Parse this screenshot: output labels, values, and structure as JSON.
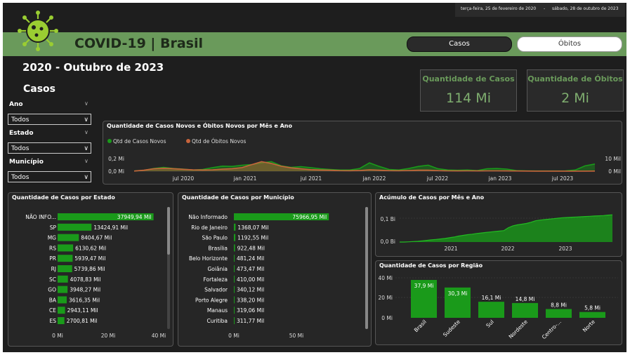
{
  "header": {
    "title": "COVID-19 | Brasil",
    "period": "2020 - Outubro de 2023",
    "section": "Casos",
    "date_start": "terça-feira, 25 de fevereiro de 2020",
    "date_sep": "-",
    "date_end": "sábado, 28 de outubro de 2023",
    "btn_casos": "Casos",
    "btn_obitos": "Óbitos"
  },
  "kpis": {
    "casos_label": "Quantidade de Casos",
    "casos_value": "114 Mi",
    "obitos_label": "Quantidade de Óbitos",
    "obitos_value": "2 Mi"
  },
  "filters": {
    "ano_label": "Ano",
    "ano_value": "Todos",
    "estado_label": "Estado",
    "estado_value": "Todos",
    "municipio_label": "Município",
    "municipio_value": "Todos"
  },
  "colors": {
    "green": "#1a9a1a",
    "accent": "#6a9a5b",
    "orange": "#c8643c"
  },
  "chart_data": [
    {
      "type": "area",
      "title": "Quantidade de Casos Novos e Óbitos Novos por Mês e Ano",
      "legend": "top-left",
      "x_ticks": [
        "jul 2020",
        "jan 2021",
        "jul 2021",
        "jan 2022",
        "jul 2022",
        "jan 2023",
        "jul 2023"
      ],
      "left_axis_ticks": [
        "0,2 Mi",
        "0,0 Mi"
      ],
      "right_axis_ticks": [
        "10 Mil",
        "0 Mil"
      ],
      "series": [
        {
          "name": "Qtd de Casos Novos",
          "values": [
            0.003,
            0.015,
            0.045,
            0.065,
            0.045,
            0.035,
            0.02,
            0.03,
            0.06,
            0.085,
            0.08,
            0.1,
            0.11,
            0.14,
            0.16,
            0.09,
            0.065,
            0.075,
            0.06,
            0.04,
            0.03,
            0.02,
            0.02,
            0.045,
            0.14,
            0.08,
            0.03,
            0.02,
            0.045,
            0.08,
            0.1,
            0.04,
            0.02,
            0.015,
            0.02,
            0.01,
            0.04,
            0.045,
            0.035,
            0.01,
            0.005,
            0.004,
            0.003,
            0.003,
            0.005,
            0.02,
            0.09,
            0.12
          ]
        },
        {
          "name": "Qtd de Óbitos Novos",
          "values": [
            0.1,
            0.8,
            2.0,
            2.5,
            2.1,
            1.6,
            1.2,
            1.0,
            1.2,
            1.7,
            2.1,
            3.0,
            5.5,
            8.0,
            6.5,
            4.2,
            2.8,
            2.0,
            1.3,
            1.0,
            0.8,
            0.5,
            0.4,
            0.6,
            1.2,
            0.8,
            0.5,
            0.4,
            0.6,
            0.8,
            0.9,
            0.5,
            0.3,
            0.25,
            0.3,
            0.25,
            0.3,
            0.3,
            0.25,
            0.15,
            0.1,
            0.08,
            0.07,
            0.05,
            0.05,
            0.06,
            0.08,
            0.1
          ]
        }
      ],
      "ylim_left": [
        0,
        0.2
      ],
      "ylim_right": [
        0,
        10
      ]
    },
    {
      "type": "bar",
      "title": "Quantidade de Casos por Estado",
      "categories": [
        "NÃO INFO...",
        "SP",
        "MG",
        "RS",
        "PR",
        "RJ",
        "SC",
        "GO",
        "BA",
        "CE",
        "ES"
      ],
      "values": [
        37949.94,
        13424.91,
        8404.67,
        6130.62,
        5939.47,
        5739.86,
        4078.83,
        3948.27,
        3616.35,
        2943.11,
        2700.81
      ],
      "labels": [
        "37949,94 Mil",
        "13424,91 Mil",
        "8404,67 Mil",
        "6130,62 Mil",
        "5939,47 Mil",
        "5739,86 Mil",
        "4078,83 Mil",
        "3948,27 Mil",
        "3616,35 Mil",
        "2943,11 Mil",
        "2700,81 Mil"
      ],
      "x_ticks": [
        "0 Mi",
        "20 Mi",
        "40 Mi"
      ],
      "xlim": [
        0,
        40000
      ]
    },
    {
      "type": "bar",
      "title": "Quantidade de Casos por Município",
      "categories": [
        "Não Informado",
        "Rio de Janeiro",
        "São Paulo",
        "Brasília",
        "Belo Horizonte",
        "Goiânia",
        "Fortaleza",
        "Salvador",
        "Porto Alegre",
        "Manaus",
        "Curitiba"
      ],
      "values": [
        75966.95,
        1368.07,
        1192.55,
        922.48,
        481.24,
        473.47,
        410.0,
        340.12,
        338.2,
        319.06,
        311.77
      ],
      "labels": [
        "75966,95 Mil",
        "1368,07 Mil",
        "1192,55 Mil",
        "922,48 Mil",
        "481,24 Mil",
        "473,47 Mil",
        "410,00 Mil",
        "340,12 Mil",
        "338,20 Mil",
        "319,06 Mil",
        "311,77 Mil"
      ],
      "x_ticks": [
        "0 Mi",
        "50 Mi"
      ],
      "xlim": [
        0,
        100000
      ]
    },
    {
      "type": "area",
      "title": "Acúmulo de Casos por Mês e Ano",
      "x_ticks": [
        "2021",
        "2022",
        "2023"
      ],
      "y_ticks": [
        "0,1 Bi",
        "0,0 Bi"
      ],
      "ylim": [
        0,
        0.12
      ],
      "series": [
        {
          "name": "",
          "values": [
            0.0,
            0.0,
            0.001,
            0.002,
            0.003,
            0.005,
            0.007,
            0.009,
            0.011,
            0.013,
            0.015,
            0.018,
            0.021,
            0.025,
            0.028,
            0.031,
            0.033,
            0.036,
            0.038,
            0.04,
            0.042,
            0.044,
            0.046,
            0.048,
            0.06,
            0.068,
            0.072,
            0.075,
            0.078,
            0.083,
            0.089,
            0.092,
            0.094,
            0.096,
            0.098,
            0.1,
            0.102,
            0.103,
            0.104,
            0.105,
            0.106,
            0.107,
            0.108,
            0.109,
            0.11,
            0.111,
            0.113,
            0.114
          ]
        }
      ]
    },
    {
      "type": "bar",
      "title": "Quantidade de Casos por Região",
      "categories": [
        "Brasil",
        "Sudeste",
        "Sul",
        "Nordeste",
        "Centro-...",
        "Norte"
      ],
      "values": [
        37.9,
        30.3,
        16.1,
        14.8,
        8.8,
        5.8
      ],
      "labels": [
        "37,9 Mi",
        "30,3 Mi",
        "16,1 Mi",
        "14,8 Mi",
        "8,8 Mi",
        "5,8 Mi"
      ],
      "y_ticks": [
        "40 Mi",
        "20 Mi",
        "0 Mi"
      ],
      "ylim": [
        0,
        40
      ]
    }
  ]
}
